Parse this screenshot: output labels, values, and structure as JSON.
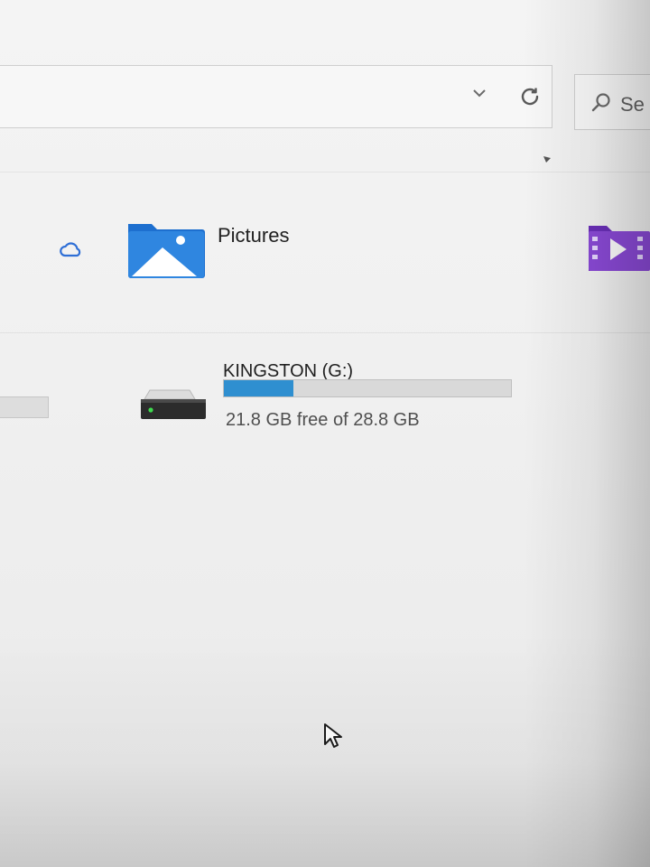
{
  "toolbar": {
    "search_placeholder": "Se"
  },
  "quick_access": {
    "items": [
      {
        "label": "Pictures",
        "icon": "pictures-folder-icon"
      }
    ]
  },
  "drives": [
    {
      "name": "KINGSTON (G:)",
      "capacity_text": "21.8 GB free of 28.8 GB",
      "used_fraction": 0.243,
      "bar_color": "#2f8fd0",
      "icon": "usb-drive-icon"
    }
  ],
  "colors": {
    "folder_blue": "#1f73d1",
    "video_purple": "#7b3bc9",
    "cloud_blue": "#2f6fd6"
  },
  "icons": {
    "dropdown": "chevron-down-icon",
    "refresh": "refresh-icon",
    "search": "search-icon",
    "cloud": "cloud-icon",
    "videos": "videos-folder-icon",
    "cursor": "mouse-cursor-icon"
  }
}
